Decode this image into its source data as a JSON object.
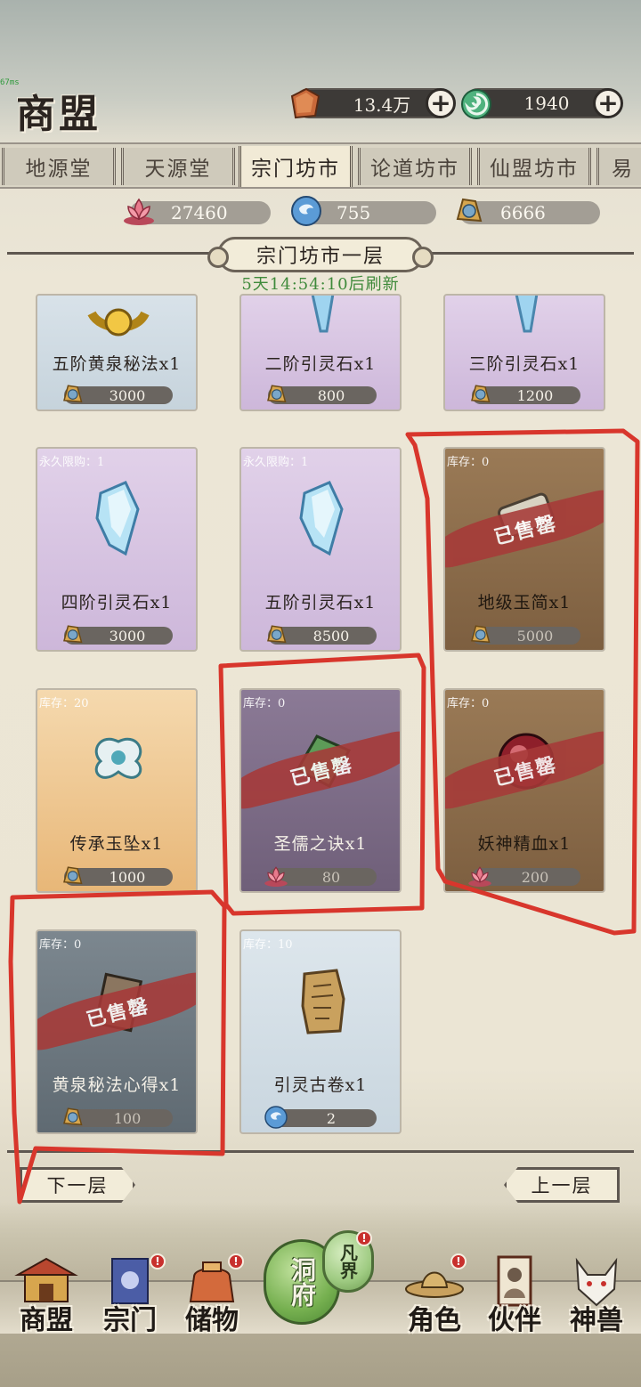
{
  "ping": "67ms",
  "header": {
    "title": "商盟",
    "spirit_stone_amount": "13.4万",
    "jade_amount": "1940"
  },
  "tabs": [
    {
      "label": "地源堂"
    },
    {
      "label": "天源堂"
    },
    {
      "label": "宗门坊市",
      "active": true
    },
    {
      "label": "论道坊市"
    },
    {
      "label": "仙盟坊市"
    },
    {
      "label": "易"
    }
  ],
  "resources": {
    "lotus": "27460",
    "orb": "755",
    "contribution": "6666"
  },
  "floor": {
    "title": "宗门坊市一层",
    "refresh_timer": "5天14:54:10后刷新"
  },
  "items": [
    {
      "name": "五阶黄泉秘法x1",
      "price": "3000",
      "currency": "contribution"
    },
    {
      "name": "二阶引灵石x1",
      "price": "800",
      "currency": "contribution"
    },
    {
      "name": "三阶引灵石x1",
      "price": "1200",
      "currency": "contribution"
    },
    {
      "tag": "永久限购：1",
      "name": "四阶引灵石x1",
      "price": "3000",
      "currency": "contribution"
    },
    {
      "tag": "永久限购：1",
      "name": "五阶引灵石x1",
      "price": "8500",
      "currency": "contribution"
    },
    {
      "tag": "库存：0",
      "name": "地级玉简x1",
      "price": "5000",
      "currency": "contribution",
      "sold_out": "已售罄"
    },
    {
      "tag": "库存：20",
      "name": "传承玉坠x1",
      "price": "1000",
      "currency": "contribution"
    },
    {
      "tag": "库存：0",
      "name": "圣儒之诀x1",
      "price": "80",
      "currency": "lotus",
      "sold_out": "已售罄"
    },
    {
      "tag": "库存：0",
      "name": "妖神精血x1",
      "price": "200",
      "currency": "lotus",
      "sold_out": "已售罄"
    },
    {
      "tag": "库存：0",
      "name": "黄泉秘法心得x1",
      "price": "100",
      "currency": "contribution",
      "sold_out": "已售罄"
    },
    {
      "tag": "库存：10",
      "name": "引灵古卷x1",
      "price": "2",
      "currency": "orb"
    }
  ],
  "pager": {
    "next": "下一层",
    "prev": "上一层"
  },
  "bottom_nav": {
    "shop": "商盟",
    "sect": "宗门",
    "storage": "储物",
    "cave": "洞府",
    "mortal": "凡界",
    "character": "角色",
    "partner": "伙伴",
    "beast": "神兽"
  },
  "colors": {
    "markup_red": "#d8362c",
    "sold_band": "#a73a38",
    "timer_green": "#3f8a3b"
  }
}
